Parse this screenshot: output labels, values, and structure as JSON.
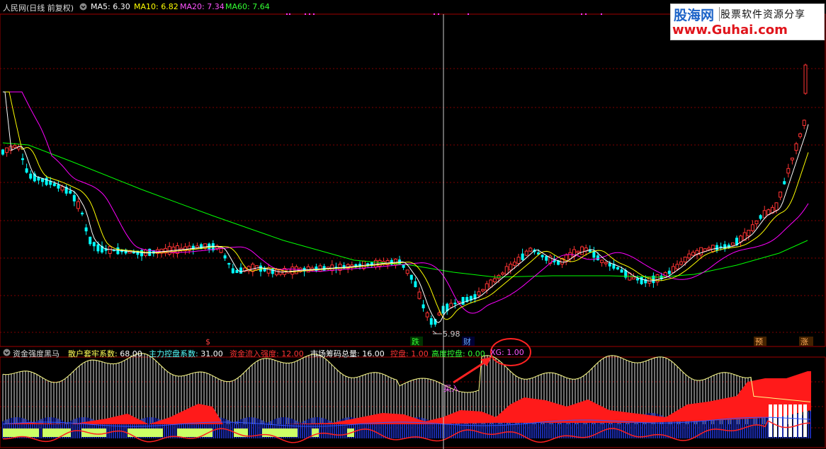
{
  "main_header": {
    "title": "人民网(日线 前复权)",
    "ma5": "MA5: 6.30",
    "ma10": "MA10: 6.82",
    "ma20": "MA20: 7.34",
    "ma60": "MA60: 7.64"
  },
  "sub_header": {
    "name": "资金强度黑马",
    "items": [
      {
        "label": "散户套牢系数:",
        "value": "68.00",
        "color": "#ffff55"
      },
      {
        "label": "主力控盘系数:",
        "value": "31.00",
        "color": "#55ffff"
      },
      {
        "label": "资金流入强度:",
        "value": "12.00",
        "color": "#ff3333"
      },
      {
        "label": "市场筹码总量:",
        "value": "16.00",
        "color": "#ffffff"
      },
      {
        "label": "控盘:",
        "value": "1.00",
        "color": "#ff3333"
      },
      {
        "label": "高度控盘:",
        "value": "0.00",
        "color": "#33ff33"
      },
      {
        "label": "XG:",
        "value": "1.00",
        "color": "#ff55ff"
      }
    ]
  },
  "watermark": {
    "brand": "股海网",
    "slogan": "股票软件资源分享",
    "url": "www.Guhai.com"
  },
  "markers": {
    "low_price": "5.98",
    "die": "跌",
    "cai": "财",
    "yu": "预",
    "zhang": "涨",
    "dollar": "$",
    "buy": "买入"
  },
  "colors": {
    "ma5": "#ffffff",
    "ma10": "#ffff00",
    "ma20": "#ff00ff",
    "ma60": "#00ff00",
    "up": "#ff3333",
    "down": "#00ffff",
    "grid": "#800000"
  },
  "chart_data": {
    "type": "candlestick",
    "series": [
      {
        "name": "MA5"
      },
      {
        "name": "MA10"
      },
      {
        "name": "MA20"
      },
      {
        "name": "MA60"
      }
    ]
  }
}
